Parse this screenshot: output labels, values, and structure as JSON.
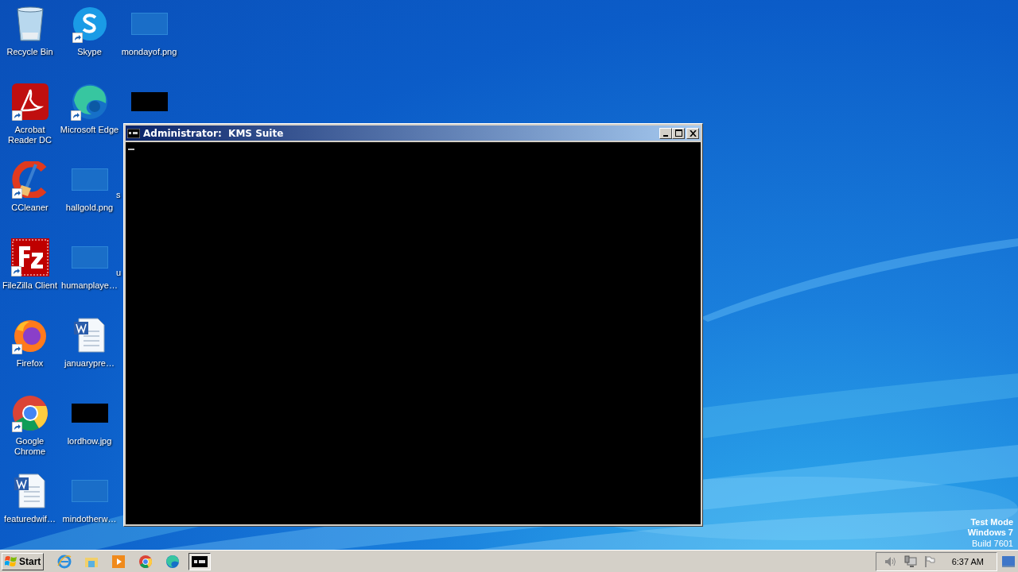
{
  "desktop_icons": [
    {
      "label": "Recycle Bin",
      "kind": "recycle-bin"
    },
    {
      "label": "Acrobat Reader DC",
      "kind": "pdf",
      "shortcut": true
    },
    {
      "label": "CCleaner",
      "kind": "ccleaner",
      "shortcut": true
    },
    {
      "label": "FileZilla Client",
      "kind": "filezilla",
      "shortcut": true
    },
    {
      "label": "Firefox",
      "kind": "firefox",
      "shortcut": true
    },
    {
      "label": "Google Chrome",
      "kind": "chrome",
      "shortcut": true
    },
    {
      "label": "featuredwif…",
      "kind": "word"
    },
    {
      "label": "Skype",
      "kind": "skype",
      "shortcut": true
    },
    {
      "label": "Microsoft Edge",
      "kind": "edge",
      "shortcut": true
    },
    {
      "label": "hallgold.png",
      "kind": "blank-image"
    },
    {
      "label": "humanplaye…",
      "kind": "blank-image"
    },
    {
      "label": "januarypre…",
      "kind": "word"
    },
    {
      "label": "lordhow.jpg",
      "kind": "black-image"
    },
    {
      "label": "mindotherw…",
      "kind": "blank-image"
    },
    {
      "label": "mondayof.png",
      "kind": "blank-image"
    },
    {
      "kind": "black-image"
    },
    {
      "label": "s",
      "kind": "hidden"
    },
    {
      "label": "u",
      "kind": "hidden"
    }
  ],
  "window": {
    "title": "Administrator:  KMS Suite"
  },
  "watermark": [
    "Test Mode",
    "Windows 7",
    "Build 7601"
  ],
  "taskbar": {
    "start": "Start",
    "items": [
      {
        "kind": "ie",
        "active": false
      },
      {
        "kind": "explorer",
        "active": false
      },
      {
        "kind": "media",
        "active": false
      },
      {
        "kind": "chrome",
        "active": false
      },
      {
        "kind": "edge",
        "active": false
      },
      {
        "kind": "cmd",
        "active": true
      }
    ],
    "clock": "6:37 AM"
  }
}
